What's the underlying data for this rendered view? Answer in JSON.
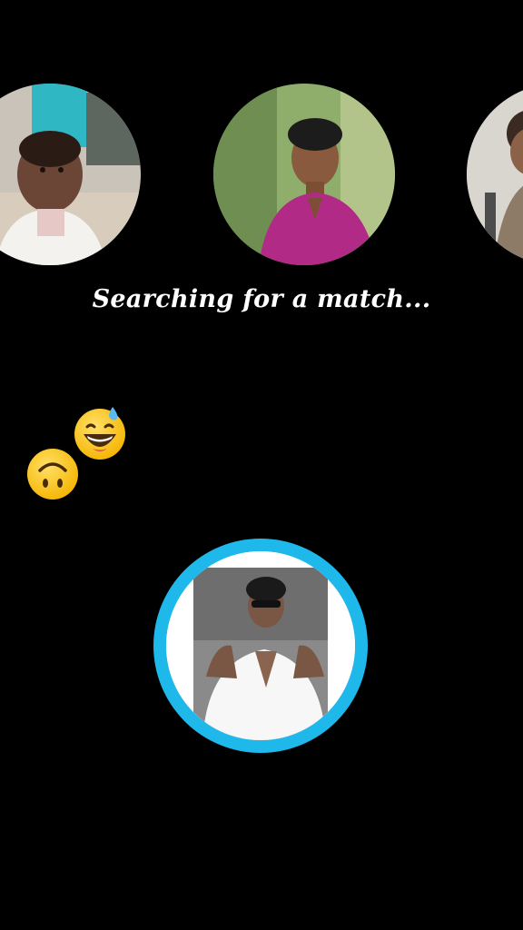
{
  "status": {
    "text": "Searching for a match..."
  },
  "candidates": [
    {
      "name": "candidate-1",
      "icon": "child-photo"
    },
    {
      "name": "candidate-2",
      "icon": "young-man-photo"
    },
    {
      "name": "candidate-3",
      "icon": "partial-person-photo"
    }
  ],
  "emojis": [
    {
      "name": "grinning-sweat-emoji",
      "glyph": "😅"
    },
    {
      "name": "upside-down-face-emoji",
      "glyph": "🙃"
    }
  ],
  "user": {
    "icon": "user-avatar-photo"
  },
  "colors": {
    "background": "#000000",
    "accent_ring": "#1fb8ea",
    "status_text": "#ffffff"
  }
}
